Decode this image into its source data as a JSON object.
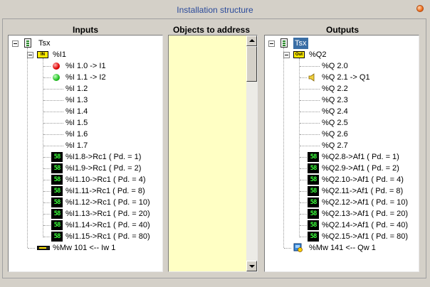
{
  "window": {
    "title": "Installation structure"
  },
  "headers": {
    "inputs": "Inputs",
    "objects": "Objects to address",
    "outputs": "Outputs"
  },
  "inputs": {
    "root": "Tsx",
    "group_icon_text": "IN",
    "group": "%I1",
    "items": [
      {
        "label": "%I 1.0 -> I1",
        "icon": "red-led-icon"
      },
      {
        "label": "%I 1.1 -> I2",
        "icon": "green-led-icon"
      },
      {
        "label": "%I 1.2",
        "icon": ""
      },
      {
        "label": "%I 1.3",
        "icon": ""
      },
      {
        "label": "%I 1.4",
        "icon": ""
      },
      {
        "label": "%I 1.5",
        "icon": ""
      },
      {
        "label": "%I 1.6",
        "icon": ""
      },
      {
        "label": "%I 1.7",
        "icon": ""
      },
      {
        "label": "%I1.8->Rc1 ( Pd. = 1)",
        "icon": "counter-icon"
      },
      {
        "label": "%I1.9->Rc1 ( Pd. = 2)",
        "icon": "counter-icon"
      },
      {
        "label": "%I1.10->Rc1 ( Pd. = 4)",
        "icon": "counter-icon"
      },
      {
        "label": "%I1.11->Rc1 ( Pd. = 8)",
        "icon": "counter-icon"
      },
      {
        "label": "%I1.12->Rc1 ( Pd. = 10)",
        "icon": "counter-icon"
      },
      {
        "label": "%I1.13->Rc1 ( Pd. = 20)",
        "icon": "counter-icon"
      },
      {
        "label": "%I1.14->Rc1 ( Pd. = 40)",
        "icon": "counter-icon"
      },
      {
        "label": "%I1.15->Rc1 ( Pd. = 80)",
        "icon": "counter-icon"
      }
    ],
    "word": "%Mw 101 <-- Iw 1"
  },
  "outputs": {
    "root": "Tsx",
    "group_icon_text": "Out",
    "group": "%Q2",
    "items": [
      {
        "label": "%Q 2.0",
        "icon": ""
      },
      {
        "label": "%Q 2.1 -> Q1",
        "icon": "speaker-icon"
      },
      {
        "label": "%Q 2.2",
        "icon": ""
      },
      {
        "label": "%Q 2.3",
        "icon": ""
      },
      {
        "label": "%Q 2.4",
        "icon": ""
      },
      {
        "label": "%Q 2.5",
        "icon": ""
      },
      {
        "label": "%Q 2.6",
        "icon": ""
      },
      {
        "label": "%Q 2.7",
        "icon": ""
      },
      {
        "label": "%Q2.8->Af1 ( Pd. = 1)",
        "icon": "counter-icon"
      },
      {
        "label": "%Q2.9->Af1 ( Pd. = 2)",
        "icon": "counter-icon"
      },
      {
        "label": "%Q2.10->Af1 ( Pd. = 4)",
        "icon": "counter-icon"
      },
      {
        "label": "%Q2.11->Af1 ( Pd. = 8)",
        "icon": "counter-icon"
      },
      {
        "label": "%Q2.12->Af1 ( Pd. = 10)",
        "icon": "counter-icon"
      },
      {
        "label": "%Q2.13->Af1 ( Pd. = 20)",
        "icon": "counter-icon"
      },
      {
        "label": "%Q2.14->Af1 ( Pd. = 40)",
        "icon": "counter-icon"
      },
      {
        "label": "%Q2.15->Af1 ( Pd. = 80)",
        "icon": "counter-icon"
      }
    ],
    "word": "%Mw 141 <-- Qw 1"
  },
  "counter_icon_text": "58",
  "colors": {
    "title": "#2a4a9a",
    "objects_bg": "#ffffc4",
    "selection": "#3a6ea5"
  }
}
